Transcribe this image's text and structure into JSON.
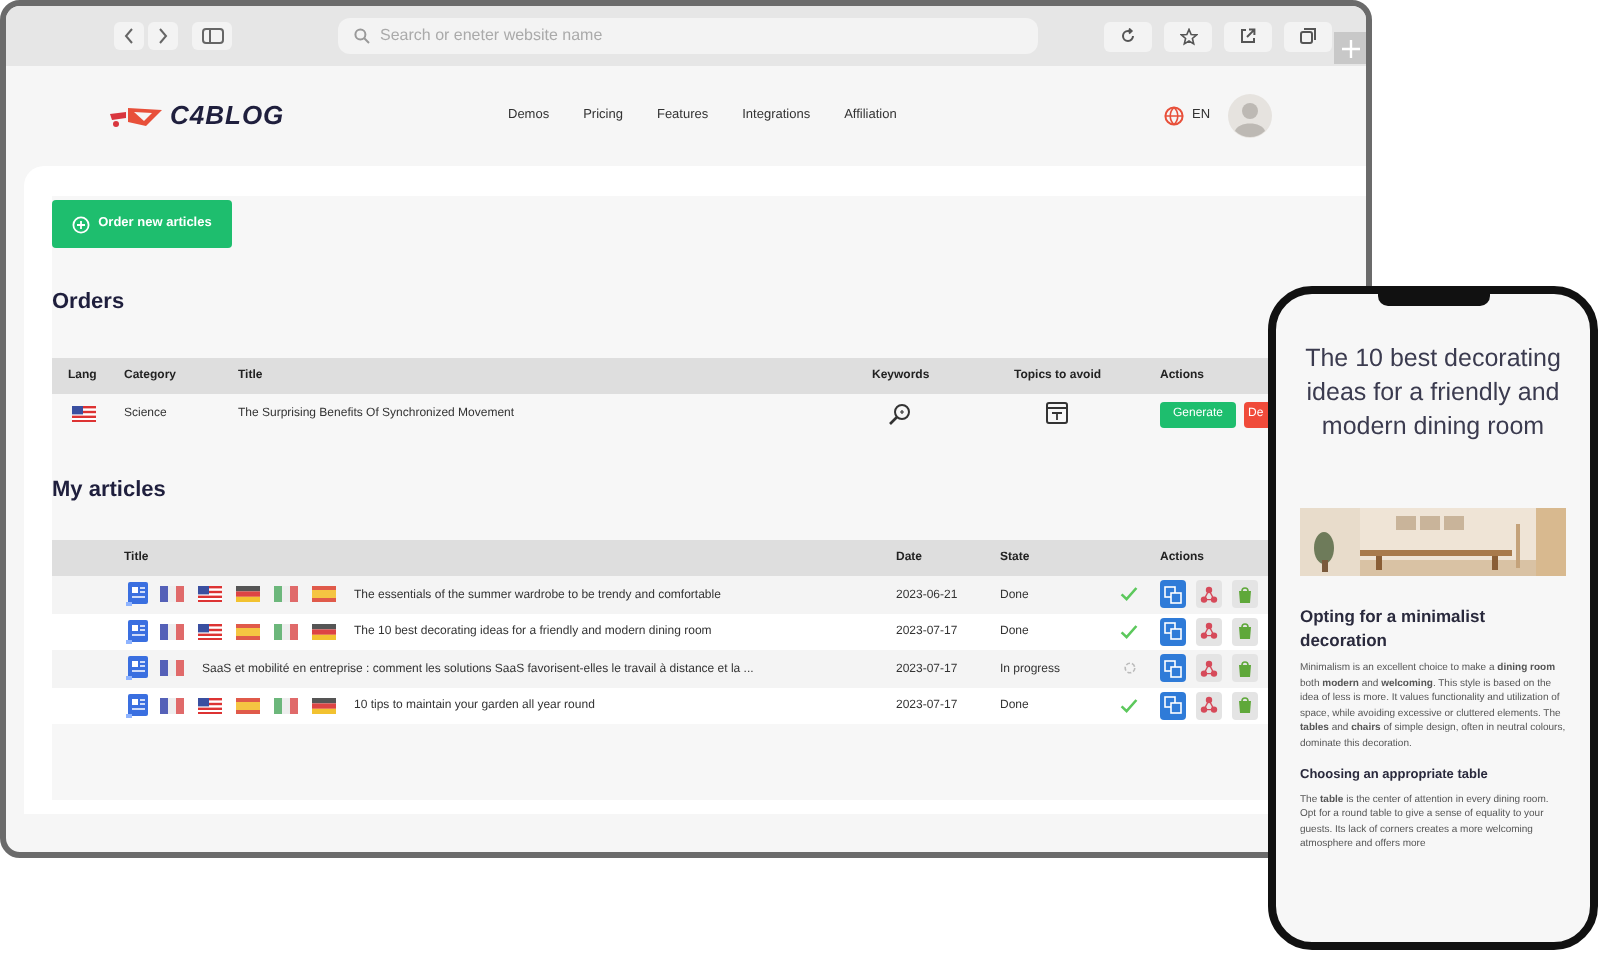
{
  "browser": {
    "search_placeholder": "Search or eneter website name"
  },
  "site": {
    "logo": "C4BLOG",
    "nav": [
      "Demos",
      "Pricing",
      "Features",
      "Integrations",
      "Affiliation"
    ],
    "language": "EN"
  },
  "order_button": "Order new articles",
  "orders": {
    "title": "Orders",
    "columns": [
      "Lang",
      "Category",
      "Title",
      "Keywords",
      "Topics to avoid",
      "Actions"
    ],
    "rows": [
      {
        "flag": {
          "kind": "us"
        },
        "category": "Science",
        "title": "The Surprising Benefits Of Synchronized Movement",
        "buttons": [
          {
            "kind": "generate",
            "label": "Generate"
          },
          {
            "kind": "delete",
            "label": "De"
          }
        ]
      }
    ]
  },
  "articles": {
    "title": "My articles",
    "columns": [
      "Title",
      "Date",
      "State",
      "Actions"
    ],
    "rows": [
      {
        "flags": [
          {
            "kind": "fr"
          },
          {
            "kind": "us"
          },
          {
            "kind": "de"
          },
          {
            "kind": "it"
          },
          {
            "kind": "es"
          }
        ],
        "title": "The essentials of the summer wardrobe to be trendy and comfortable",
        "date": "2023-06-21",
        "state": "Done",
        "kind": "done"
      },
      {
        "flags": [
          {
            "kind": "fr"
          },
          {
            "kind": "us"
          },
          {
            "kind": "es"
          },
          {
            "kind": "it"
          },
          {
            "kind": "de"
          }
        ],
        "title": "The 10 best decorating ideas for a friendly and modern dining room",
        "date": "2023-07-17",
        "state": "Done",
        "kind": "done"
      },
      {
        "flags": [
          {
            "kind": "fr"
          }
        ],
        "title": "SaaS et mobilité en entreprise : comment les solutions SaaS favorisent-elles le travail à distance et la ...",
        "date": "2023-07-17",
        "state": "In progress",
        "kind": "progress"
      },
      {
        "flags": [
          {
            "kind": "fr"
          },
          {
            "kind": "us"
          },
          {
            "kind": "es"
          },
          {
            "kind": "it"
          },
          {
            "kind": "de"
          }
        ],
        "title": "10 tips to maintain your garden all year round",
        "date": "2023-07-17",
        "state": "Done",
        "kind": "done"
      }
    ]
  },
  "phone": {
    "title": "The 10 best decorating ideas for a friendly and modern dining room",
    "sections": [
      {
        "heading": "Opting for a minimalist decoration",
        "text": "Minimalism is an excellent choice to make a **dining room** both **modern** and **welcoming**. This style is based on the idea of less is more. It values functionality and utilization of space, while avoiding excessive or cluttered elements. The **tables** and **chairs** of simple design, often in neutral colours, dominate this decoration."
      },
      {
        "heading": "Choosing an appropriate table",
        "text": "The **table** is the center of attention in every dining room. Opt for a round table to give a sense of equality to your guests. Its lack of corners creates a more welcoming atmosphere and offers more"
      }
    ]
  }
}
